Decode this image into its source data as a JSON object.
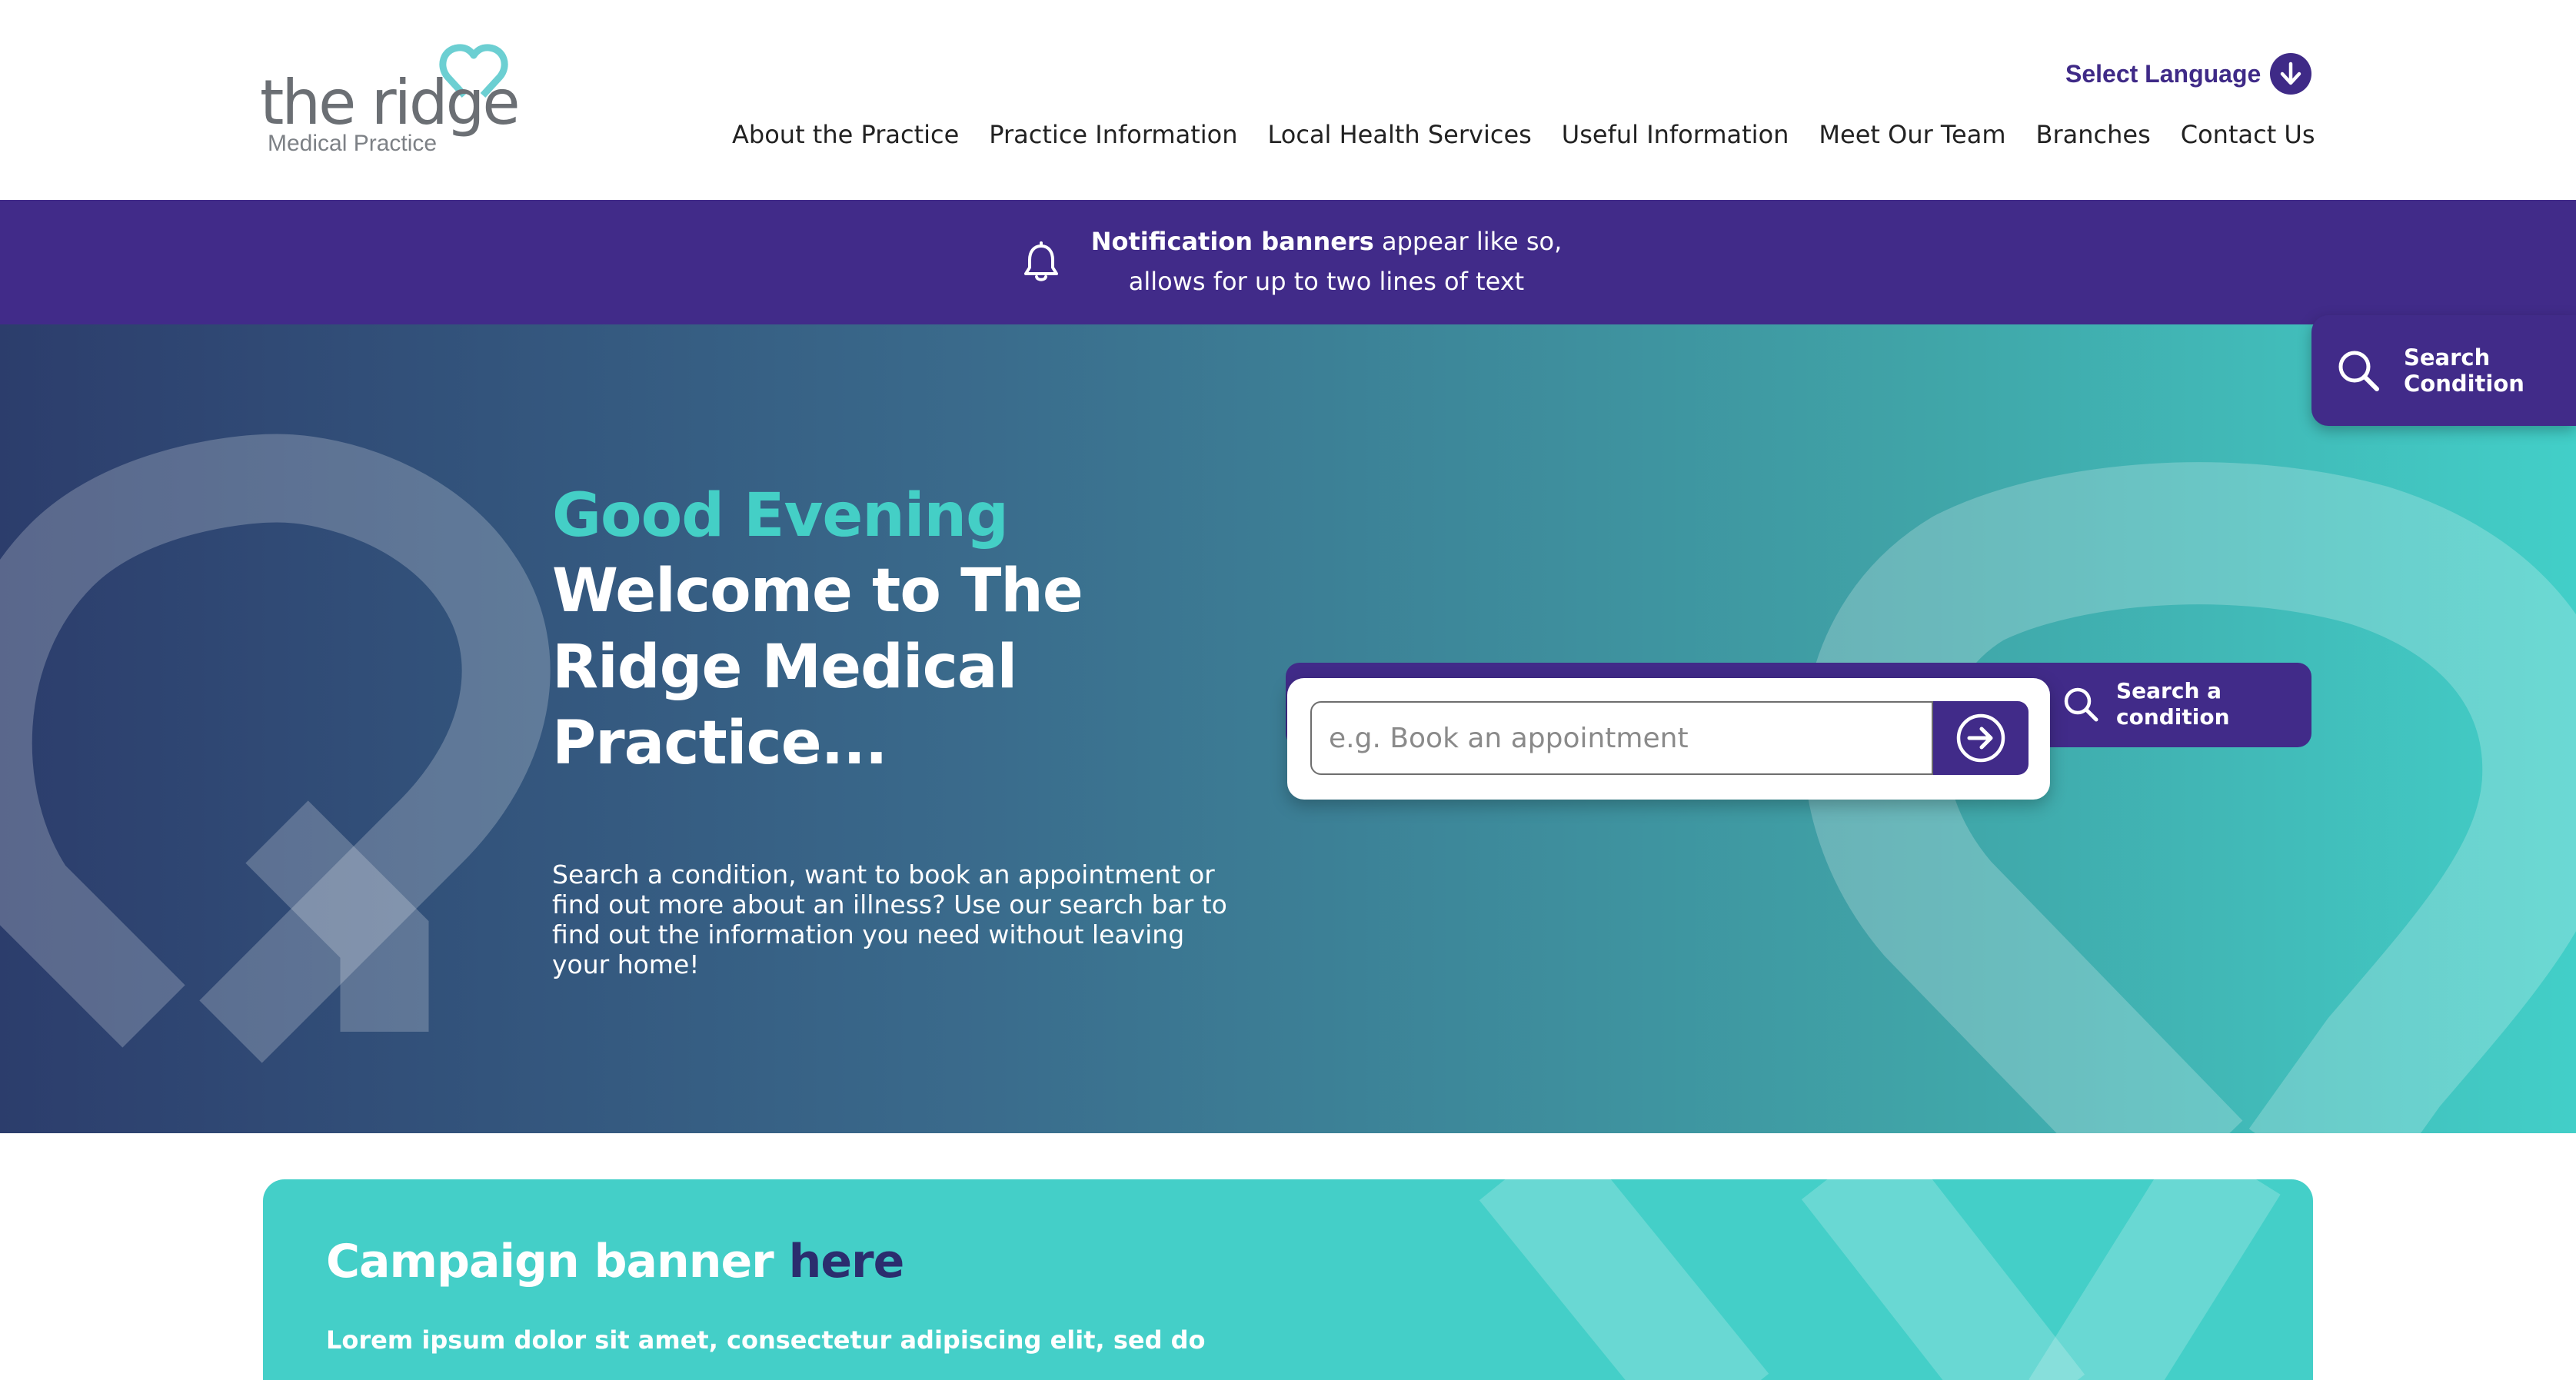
{
  "header": {
    "logo": {
      "main": "the ridge",
      "sub": "Medical Practice"
    },
    "language": {
      "label": "Select Language",
      "icon": "arrow-down-circle-icon"
    },
    "nav": [
      "About the Practice",
      "Practice Information",
      "Local Health Services",
      "Useful Information",
      "Meet Our Team",
      "Branches",
      "Contact Us"
    ]
  },
  "notification": {
    "icon": "bell-icon",
    "bold": "Notification banners",
    "text_rest": " appear like so,",
    "line2": "allows for up to two lines of text"
  },
  "hero": {
    "greeting": "Good Evening",
    "welcome": "Welcome to The Ridge Medical Practice...",
    "description": "Search a condition, want to book an appointment or find out more about an illness? Use our search bar to find out the information you need without leaving your home!",
    "search": {
      "placeholder": "e.g. Book an appointment",
      "value": "",
      "submit_icon": "arrow-right-circle-icon",
      "tab_label_line1": "Search a",
      "tab_label_line2": "condition"
    }
  },
  "float_search": {
    "icon": "search-icon",
    "line1": "Search",
    "line2": "Condition"
  },
  "campaign": {
    "title": "Campaign banner ",
    "title_accent": "here",
    "text": "Lorem ipsum dolor sit amet, consectetur adipiscing elit, sed do"
  },
  "colors": {
    "brand_purple": "#412b89",
    "brand_teal": "#44cfc8",
    "accent_navy": "#2b2d6e",
    "hero_start": "#2c3d6c",
    "hero_end": "#42cfc8"
  }
}
